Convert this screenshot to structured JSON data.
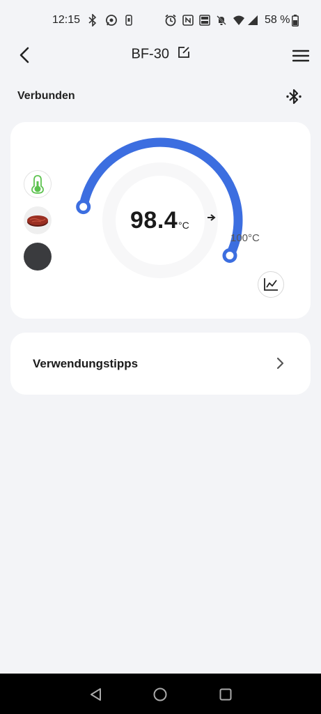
{
  "status_bar": {
    "time": "12:15",
    "battery_percent": "58 %",
    "icons": [
      "bluetooth-icon",
      "whatsapp-icon",
      "phone-small-icon",
      "alarm-icon",
      "nfc-icon",
      "volte-icon",
      "bell-muted-icon",
      "wifi-icon",
      "signal-icon",
      "battery-icon"
    ]
  },
  "header": {
    "title": "BF-30",
    "icons": [
      "back-icon",
      "edit-icon",
      "menu-icon"
    ]
  },
  "connection": {
    "status": "Verbunden",
    "icon": "bluetooth-connected-icon"
  },
  "probe": {
    "current_temp": "98.4",
    "unit": "°C",
    "target_temp": "100°C",
    "progress_fraction": 0.984,
    "side_buttons": [
      "thermometer-icon",
      "steak-icon",
      "dark-circle-icon"
    ],
    "chart_icon": "line-chart-icon"
  },
  "tips": {
    "label": "Verwendungstipps"
  },
  "colors": {
    "accent": "#3c6ee0",
    "background": "#f3f4f7",
    "card": "#ffffff",
    "thermometer_green": "#5cc24e",
    "steak": "#8c2b20",
    "dark_circle": "#3a3b3e"
  },
  "nav": {
    "icons": [
      "nav-back-icon",
      "nav-home-icon",
      "nav-recents-icon"
    ]
  }
}
